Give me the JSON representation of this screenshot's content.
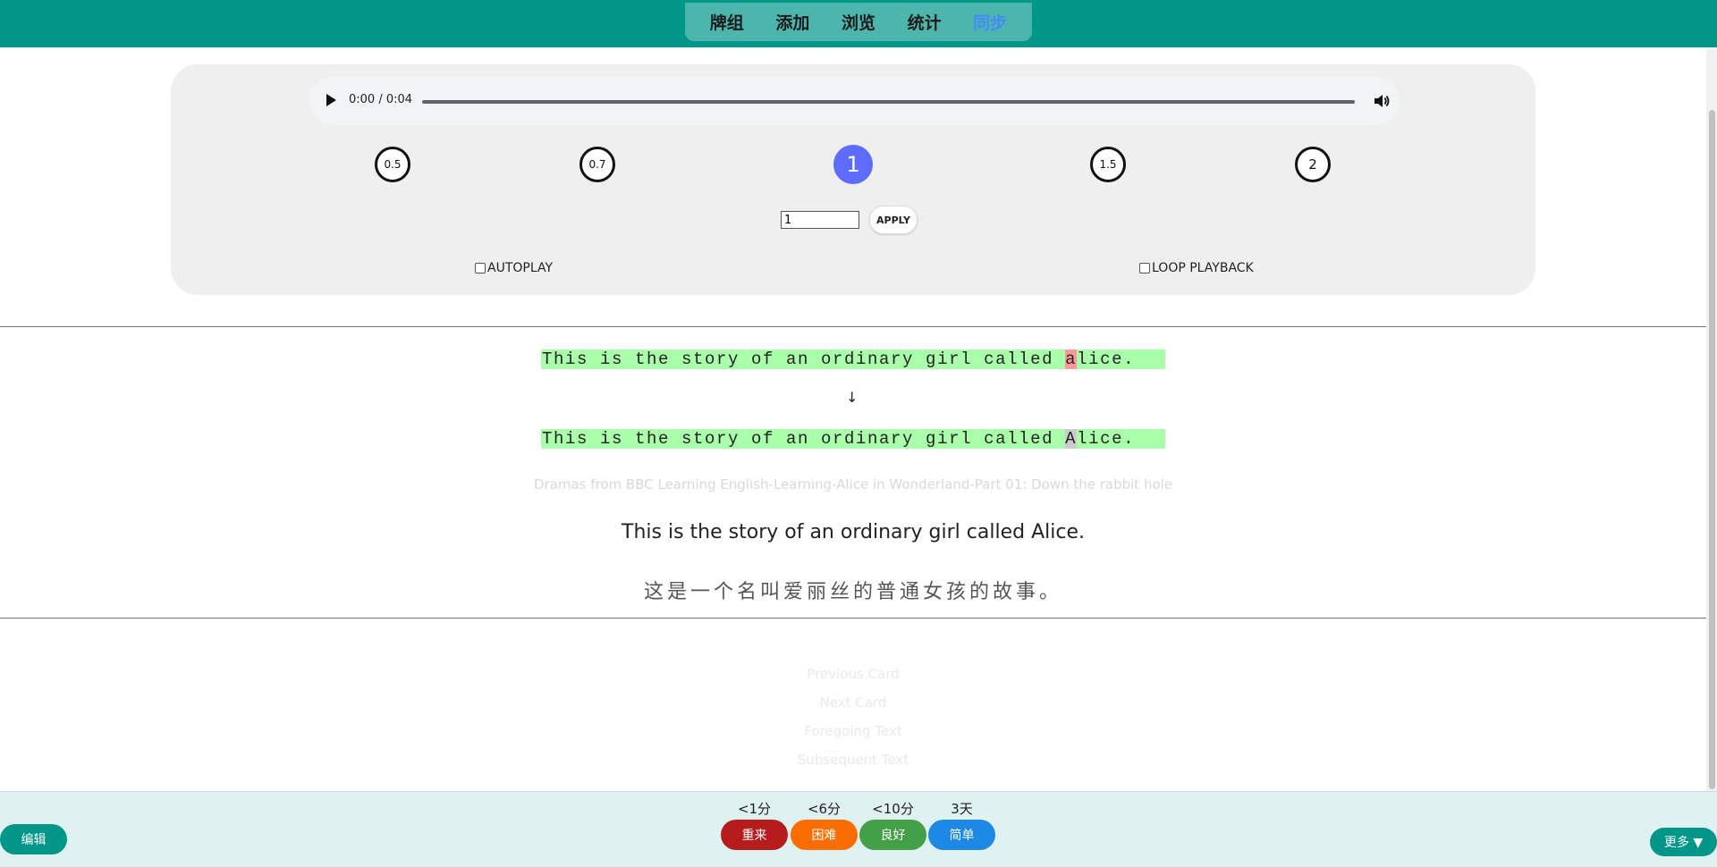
{
  "nav": {
    "tabs": [
      {
        "label": "牌组"
      },
      {
        "label": "添加"
      },
      {
        "label": "浏览"
      },
      {
        "label": "统计"
      },
      {
        "label": "同步"
      }
    ]
  },
  "player": {
    "time": "0:00 / 0:04",
    "speeds": [
      "0.5",
      "0.7",
      "1",
      "1.5",
      "2"
    ],
    "active_speed": "1",
    "speed_input_value": "1",
    "apply_label": "APPLY",
    "autoplay_label": "AUTOPLAY",
    "loop_label": "LOOP PLAYBACK"
  },
  "comparison": {
    "typed_pre": "This is the story of an ordinary girl called ",
    "typed_diff": "a",
    "typed_post": "lice.",
    "arrow": "↓",
    "correct_pre": "This is the story of an ordinary girl called ",
    "correct_diff": "A",
    "correct_post": "lice."
  },
  "card": {
    "source": "Dramas from BBC Learning English-Learning-Alice in Wonderland-Part 01: Down the rabbit hole",
    "sentence_en": "This is the story of an ordinary girl called Alice.",
    "sentence_zh": "这是一个名叫爱丽丝的普通女孩的故事。"
  },
  "links": {
    "previous": "Previous Card",
    "next": "Next Card",
    "foregoing": "Foregoing Text",
    "subsequent": "Subsequent Text"
  },
  "bottom": {
    "edit_label": "编辑",
    "more_label": "更多 ▼",
    "answers": [
      {
        "time": "<1分",
        "label": "重来",
        "color": "#b71c1c"
      },
      {
        "time": "<6分",
        "label": "困难",
        "color": "#fb6d00"
      },
      {
        "time": "<10分",
        "label": "良好",
        "color": "#43a047"
      },
      {
        "time": "3天",
        "label": "简单",
        "color": "#1e88e5"
      }
    ]
  }
}
